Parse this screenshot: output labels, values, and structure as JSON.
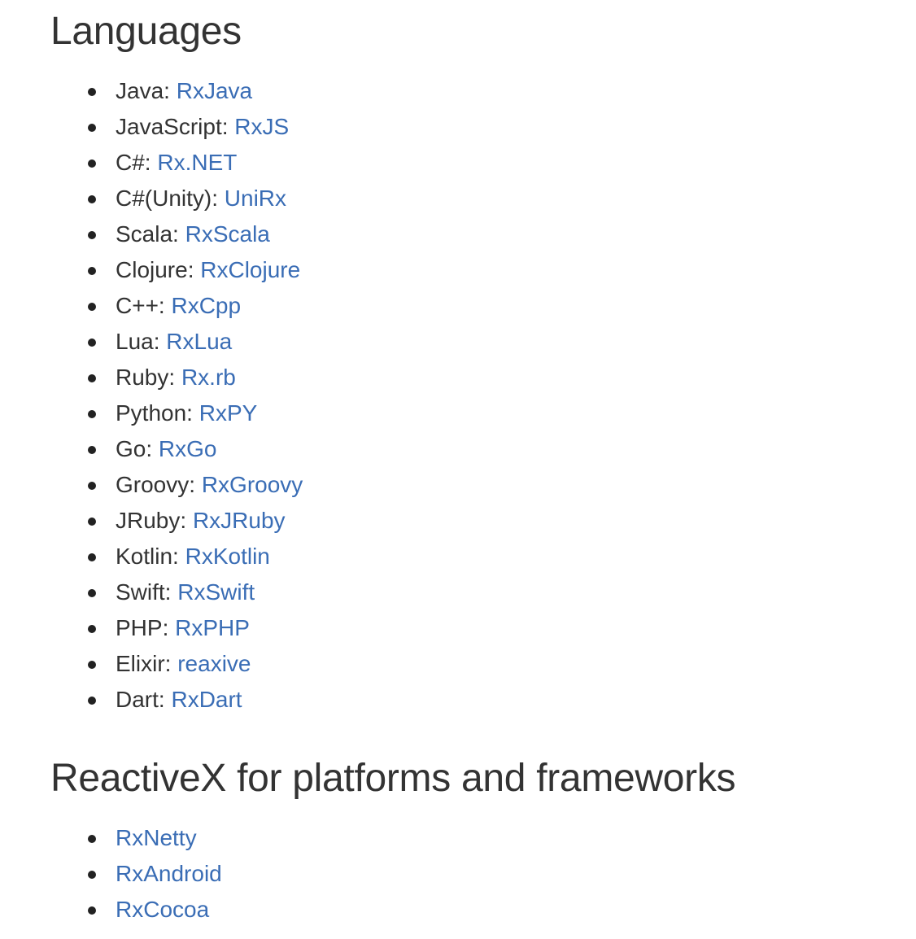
{
  "languages": {
    "heading": "Languages",
    "items": [
      {
        "language": "Java:",
        "link": "RxJava"
      },
      {
        "language": "JavaScript:",
        "link": "RxJS"
      },
      {
        "language": "C#:",
        "link": "Rx.NET"
      },
      {
        "language": "C#(Unity):",
        "link": "UniRx"
      },
      {
        "language": "Scala:",
        "link": "RxScala"
      },
      {
        "language": "Clojure:",
        "link": "RxClojure"
      },
      {
        "language": "C++:",
        "link": "RxCpp"
      },
      {
        "language": "Lua:",
        "link": "RxLua"
      },
      {
        "language": "Ruby:",
        "link": "Rx.rb"
      },
      {
        "language": "Python:",
        "link": "RxPY"
      },
      {
        "language": "Go:",
        "link": "RxGo"
      },
      {
        "language": "Groovy:",
        "link": "RxGroovy"
      },
      {
        "language": "JRuby:",
        "link": "RxJRuby"
      },
      {
        "language": "Kotlin:",
        "link": "RxKotlin"
      },
      {
        "language": "Swift:",
        "link": "RxSwift"
      },
      {
        "language": "PHP:",
        "link": "RxPHP"
      },
      {
        "language": "Elixir:",
        "link": "reaxive"
      },
      {
        "language": "Dart:",
        "link": "RxDart"
      }
    ]
  },
  "platforms": {
    "heading": "ReactiveX for platforms and frameworks",
    "items": [
      {
        "link": "RxNetty"
      },
      {
        "link": "RxAndroid"
      },
      {
        "link": "RxCocoa"
      }
    ]
  },
  "colors": {
    "text": "#333333",
    "link": "#3a6db5",
    "background": "#ffffff"
  }
}
